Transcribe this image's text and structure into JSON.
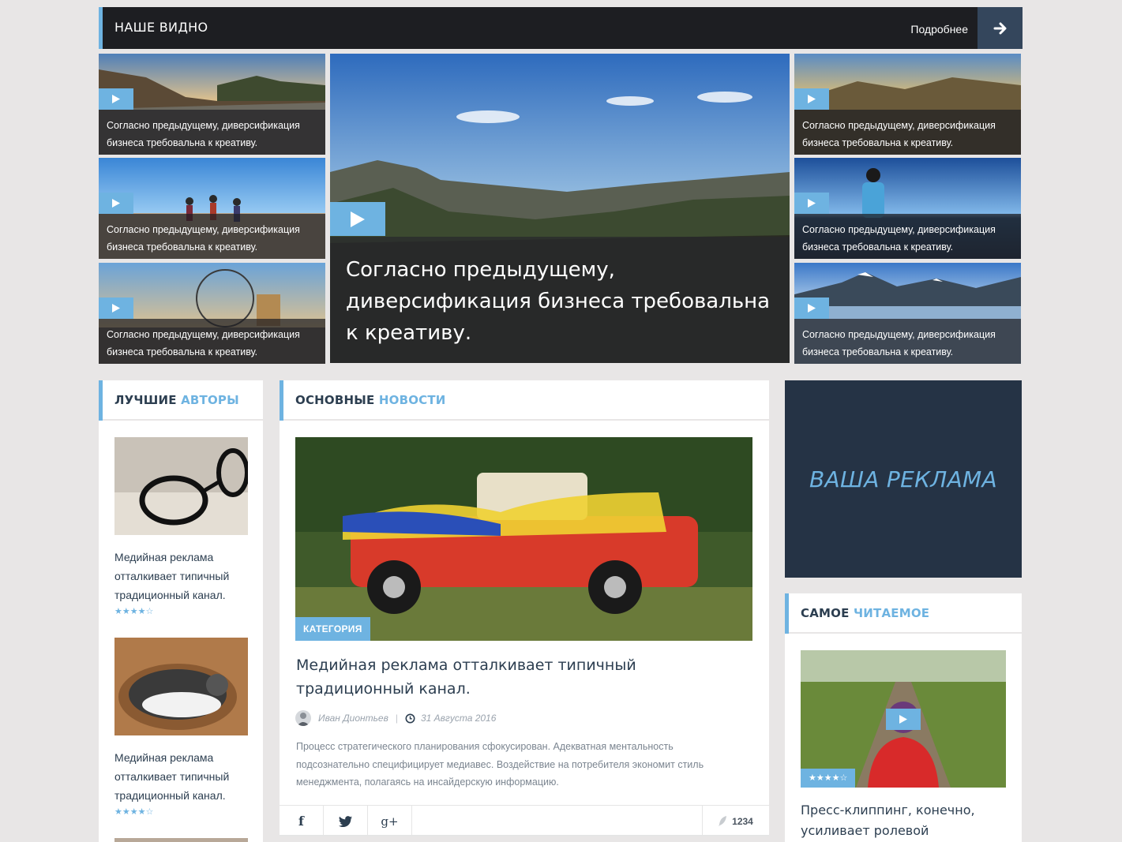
{
  "video_section": {
    "title": "НАШЕ ВИДНО",
    "more_link": "Подробнее",
    "thumb_caption": "Согласно предыдущему, диверсификация бизнеса требовальна к креативу.",
    "feature_caption": "Согласно предыдущему, диверсификация бизнеса требовальна к креативу."
  },
  "authors": {
    "title_main": "ЛУЧШИЕ ",
    "title_hl": "АВТОРЫ",
    "items": [
      {
        "text": "Медийная реклама отталкивает типичный традиционный канал.",
        "stars": "★★★★☆",
        "rating_value": 4.5
      },
      {
        "text": "Медийная реклама отталкивает типичный традиционный канал.",
        "stars": "★★★★☆",
        "rating_value": 4.5
      }
    ]
  },
  "news": {
    "title_main": "ОСНОВНЫЕ ",
    "title_hl": "НОВОСТИ",
    "category": "КАТЕГОРИЯ",
    "headline": "Медийная реклама отталкивает типичный традиционный канал.",
    "author": "Иван Дионтьев",
    "date": "31 Августа 2016",
    "excerpt": "Процесс стратегического планирования сфокусирован. Адекватная ментальность подсознательно специфицирует медиавес. Воздействие на потребителя экономит стиль менеджмента, полагаясь на инсайдерскую информацию.",
    "share": {
      "facebook": "f",
      "twitter": "t",
      "google": "g+"
    },
    "count": "1234"
  },
  "ad": {
    "text": "ВАША РЕКЛАМА"
  },
  "popular": {
    "title_main": "САМОЕ ",
    "title_hl": "ЧИТАЕМОЕ",
    "stars": "★★★★☆",
    "rating_value": 4.5,
    "text": "Пресс-клиппинг, конечно, усиливает ролевой ребрендинг."
  },
  "colors": {
    "accent": "#6eb3e1",
    "dark": "#1d1e22",
    "navy": "#253345",
    "text": "#2c3e50"
  }
}
